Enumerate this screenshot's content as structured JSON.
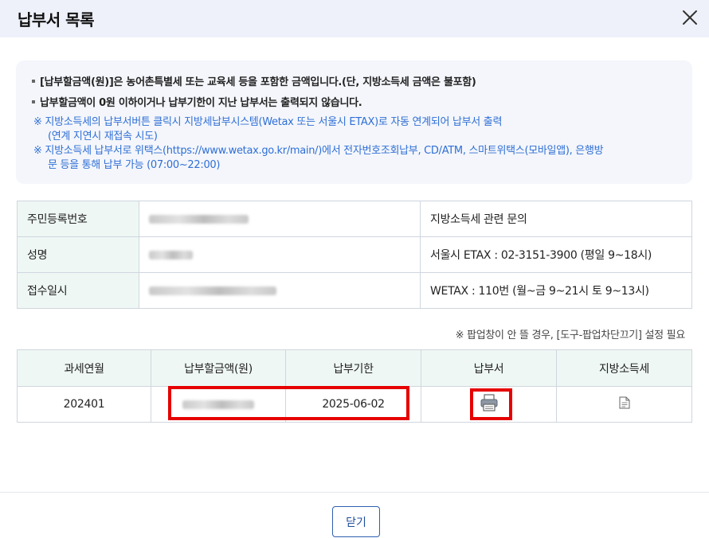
{
  "header": {
    "title": "납부서 목록"
  },
  "notice": {
    "items": [
      {
        "type": "bullet",
        "text": "[납부할금액(원)]은 농어촌특별세 또는 교육세 등을 포함한 금액입니다.(단, 지방소득세 금액은 불포함)"
      },
      {
        "type": "bullet",
        "text": "납부할금액이 0원 이하이거나 납부기한이 지난 납부서는 출력되지 않습니다."
      },
      {
        "type": "note",
        "text": "※ 지방소득세의 납부서버튼 클릭시 지방세납부시스템(Wetax 또는 서울시 ETAX)로 자동 연계되어 납부서 출력"
      },
      {
        "type": "note-cont",
        "text": "(연계 지연시 재접속 시도)"
      },
      {
        "type": "note",
        "text": "※ 지방소득세 납부서로 위택스(https://www.wetax.go.kr/main/)에서 전자번호조회납부, CD/ATM, 스마트위택스(모바일앱), 은행방"
      },
      {
        "type": "note-cont",
        "text": "문 등을 통해 납부 가능 (07:00~22:00)"
      }
    ]
  },
  "info": {
    "rows": [
      {
        "label": "주민등록번호",
        "contact": "지방소득세 관련 문의"
      },
      {
        "label": "성명",
        "contact": "서울시 ETAX : 02-3151-3900 (평일 9~18시)"
      },
      {
        "label": "접수일시",
        "contact": "WETAX : 110번 (월~금 9~21시 토 9~13시)"
      }
    ]
  },
  "popup_note": "※ 팝업창이 안 뜰 경우, [도구-팝업차단끄기] 설정 필요",
  "table": {
    "headers": [
      "과세연월",
      "납부할금액(원)",
      "납부기한",
      "납부서",
      "지방소득세"
    ],
    "rows": [
      {
        "period": "202401",
        "due_date": "2025-06-02"
      }
    ]
  },
  "footer": {
    "close_label": "닫기"
  },
  "icons": {
    "close": "close-icon",
    "print": "print-icon",
    "document": "document-icon"
  },
  "colors": {
    "header_bg": "#eef1f9",
    "label_bg": "#eef7f4",
    "note_blue": "#2f6fd6",
    "highlight": "#e60000",
    "button_border": "#2e5fb0"
  }
}
